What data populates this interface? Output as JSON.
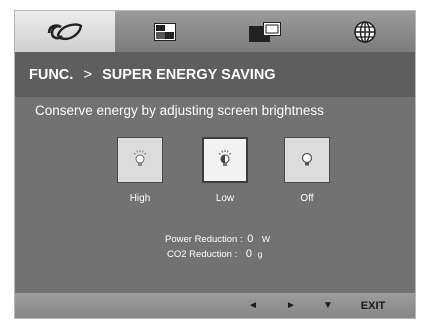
{
  "tabs": [
    {
      "icon": "energy-leaf-icon",
      "active": true
    },
    {
      "icon": "picture-icon",
      "active": false
    },
    {
      "icon": "pip-icon",
      "active": false
    },
    {
      "icon": "globe-icon",
      "active": false
    }
  ],
  "header": {
    "menu": "FUNC.",
    "separator": ">",
    "submenu": "SUPER ENERGY SAVING"
  },
  "description": "Conserve energy by adjusting screen brightness",
  "options": [
    {
      "label": "High",
      "icon": "bulb-high-icon",
      "selected": false
    },
    {
      "label": "Low",
      "icon": "bulb-low-icon",
      "selected": true
    },
    {
      "label": "Off",
      "icon": "bulb-off-icon",
      "selected": false
    }
  ],
  "stats": {
    "power_label": "Power Reduction :",
    "power_value": "0",
    "power_unit": "W",
    "co2_label": "CO2 Reduction :",
    "co2_value": "0",
    "co2_unit": "g"
  },
  "footer": {
    "left": "◄",
    "right": "►",
    "down": "▼",
    "exit": "EXIT"
  },
  "colors": {
    "header_bg": "#5e5e5e",
    "content_bg": "#727272",
    "active_tab": "#e6e6e6"
  }
}
